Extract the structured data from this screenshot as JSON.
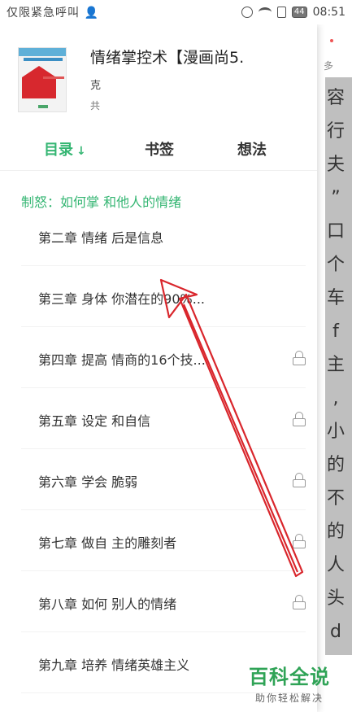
{
  "status_bar": {
    "carrier": "仅限紧急呼叫 👤",
    "battery": "44",
    "time": "08:51"
  },
  "reader": {
    "top_text": "多",
    "chars": [
      "容",
      "行",
      "夫",
      "”",
      "口",
      "个",
      "车",
      "f",
      "主",
      ",",
      "小",
      "的",
      "不",
      "的",
      "人",
      "头",
      "d"
    ]
  },
  "book": {
    "title": "情绪掌控术【漫画尚5.",
    "author": "克",
    "count": "共"
  },
  "tabs": [
    {
      "label": "目录",
      "sort_icon": "↓",
      "active": true
    },
    {
      "label": "书签",
      "active": false
    },
    {
      "label": "想法",
      "active": false
    }
  ],
  "toc_header": "制怒：如何掌     和他人的情绪",
  "toc_items": [
    {
      "label": "第二章 情绪     后是信息",
      "locked": false
    },
    {
      "label": "第三章 身体     你潜在的90%...",
      "locked": false
    },
    {
      "label": "第四章 提高     情商的16个技...",
      "locked": true
    },
    {
      "label": "第五章 设定     和自信",
      "locked": true
    },
    {
      "label": "第六章 学会     脆弱",
      "locked": true
    },
    {
      "label": "第七章 做自     主的雕刻者",
      "locked": true
    },
    {
      "label": "第八章 如何     别人的情绪",
      "locked": true
    },
    {
      "label": "第九章 培养     情绪英雄主义",
      "locked": false
    }
  ],
  "watermark": {
    "title": "百科全说",
    "subtitle": "助你轻松解决"
  },
  "colors": {
    "accent": "#35b673",
    "arrow": "#d9262c"
  }
}
